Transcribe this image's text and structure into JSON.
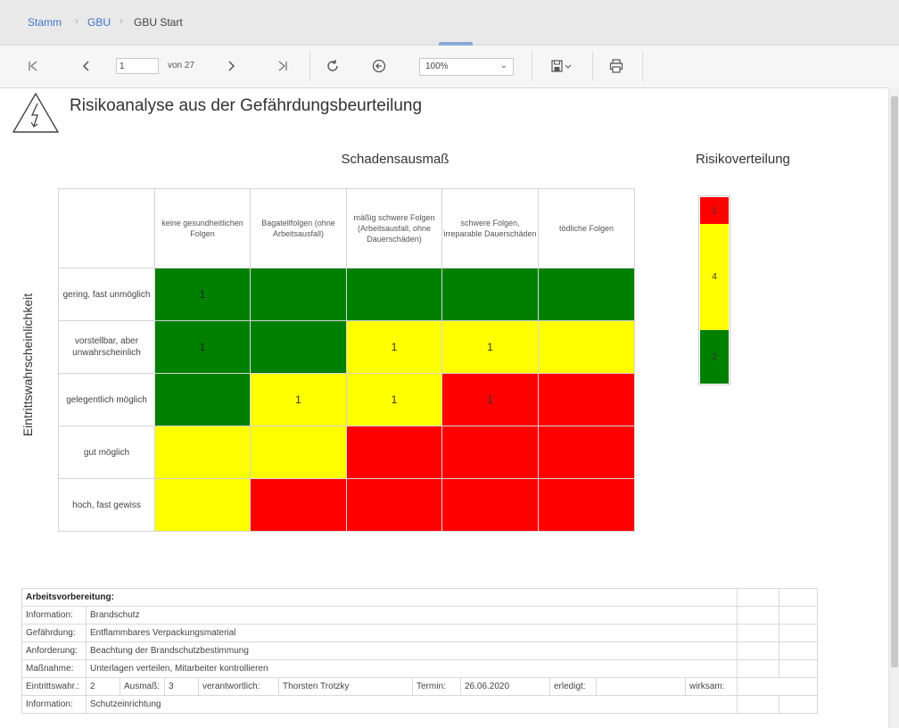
{
  "breadcrumb": {
    "items": [
      "Stamm",
      "GBU",
      "GBU Start"
    ]
  },
  "toolbar": {
    "page_current": "1",
    "page_of": "von 27",
    "zoom": "100%"
  },
  "report": {
    "title": "Risikoanalyse aus der Gefährdungsbeurteilung"
  },
  "matrix": {
    "heading": "Schadensausmaß",
    "probability_label": "Eintrittswahrscheinlichkeit",
    "columns": [
      "keine gesundheitlichen Folgen",
      "Bagatellfolgen (ohne Arbeitsausfall)",
      "mäßig schwere Folgen (Arbeitsausfall, ohne Dauerschäden)",
      "schwere Folgen, irreparable Dauerschäden",
      "tödliche Folgen"
    ],
    "rows": [
      {
        "label": "gering, fast unmöglich",
        "cells": [
          {
            "c": "green",
            "v": "1"
          },
          {
            "c": "green",
            "v": ""
          },
          {
            "c": "green",
            "v": ""
          },
          {
            "c": "green",
            "v": ""
          },
          {
            "c": "green",
            "v": ""
          }
        ]
      },
      {
        "label": "vorstellbar, aber unwahrscheinlich",
        "cells": [
          {
            "c": "green",
            "v": "1"
          },
          {
            "c": "green",
            "v": ""
          },
          {
            "c": "yellow",
            "v": "1"
          },
          {
            "c": "yellow",
            "v": "1"
          },
          {
            "c": "yellow",
            "v": ""
          }
        ]
      },
      {
        "label": "gelegentlich möglich",
        "cells": [
          {
            "c": "green",
            "v": ""
          },
          {
            "c": "yellow",
            "v": "1"
          },
          {
            "c": "yellow",
            "v": "1"
          },
          {
            "c": "red",
            "v": "1"
          },
          {
            "c": "red",
            "v": ""
          }
        ]
      },
      {
        "label": "gut möglich",
        "cells": [
          {
            "c": "yellow",
            "v": ""
          },
          {
            "c": "yellow",
            "v": ""
          },
          {
            "c": "red",
            "v": ""
          },
          {
            "c": "red",
            "v": ""
          },
          {
            "c": "red",
            "v": ""
          }
        ]
      },
      {
        "label": "hoch, fast gewiss",
        "cells": [
          {
            "c": "yellow",
            "v": ""
          },
          {
            "c": "red",
            "v": ""
          },
          {
            "c": "red",
            "v": ""
          },
          {
            "c": "red",
            "v": ""
          },
          {
            "c": "red",
            "v": ""
          }
        ]
      }
    ]
  },
  "distribution": {
    "heading": "Risikoverteilung",
    "segments": [
      {
        "color": "red",
        "value": "1",
        "share": 1
      },
      {
        "color": "yellow",
        "value": "4",
        "share": 4
      },
      {
        "color": "green",
        "value": "2",
        "share": 2
      }
    ]
  },
  "details": {
    "heading": "Arbeitsvorbereitung:",
    "rows": [
      {
        "label": "Information:",
        "value": "Brandschutz"
      },
      {
        "label": "Gefährdung:",
        "value": "Entflammbares Verpackungsmaterial"
      },
      {
        "label": "Anforderung:",
        "value": "Beachtung der Brandschutzbestimmung"
      },
      {
        "label": "Maßnahme:",
        "value": "Unterlagen verteilen, Mitarbeiter kontrollieren"
      }
    ],
    "summary": {
      "prob_label": "Eintrittswahr.:",
      "prob_value": "2",
      "impact_label": "Ausmaß:",
      "impact_value": "3",
      "resp_label": "verantwortlich:",
      "resp_value": "Thorsten Trotzky",
      "date_label": "Termin:",
      "date_value": "26.06.2020",
      "done_label": "erledigt:",
      "effective_label": "wirksam:"
    },
    "last_row": {
      "label": "Information:",
      "value": "Schutzeinrichtung"
    }
  },
  "colors": {
    "green": "#008000",
    "yellow": "#ffff00",
    "red": "#ff0000",
    "link": "#3f76c7"
  }
}
